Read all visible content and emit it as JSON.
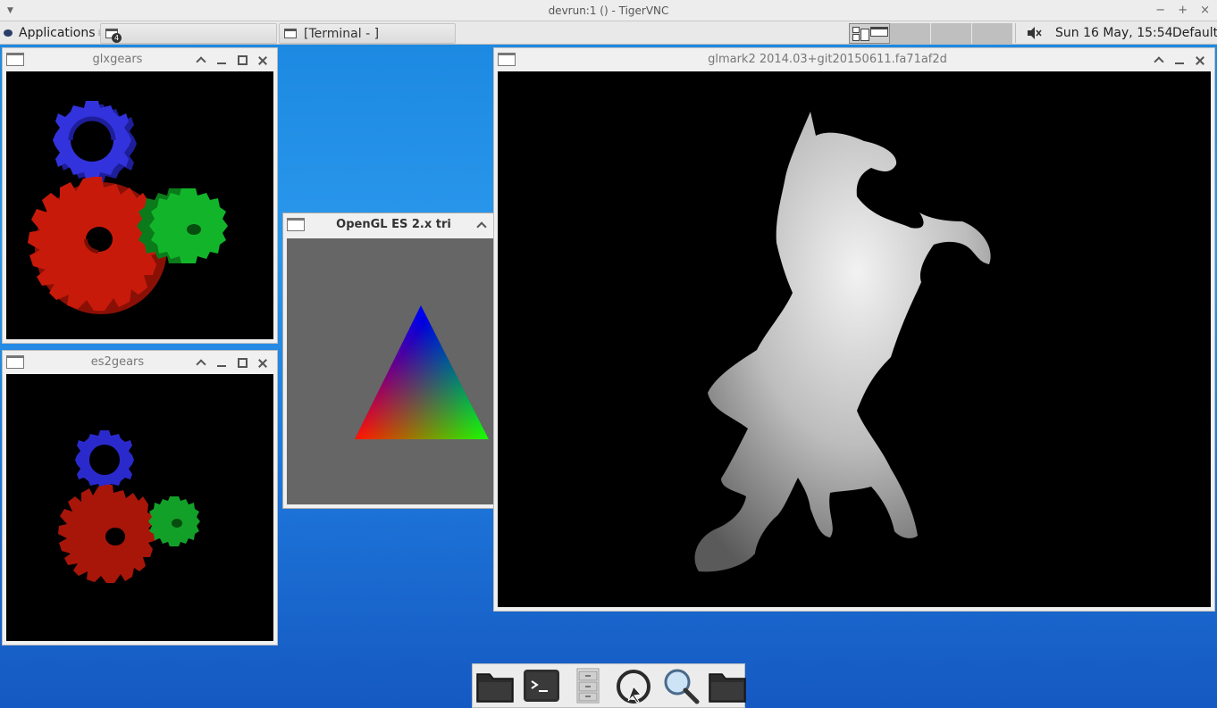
{
  "vnc": {
    "title": "devrun:1 () - TigerVNC",
    "controls": [
      "−",
      "+",
      "×"
    ]
  },
  "panel": {
    "applications_label": "Applications",
    "task_badge": "4",
    "terminal_task_label": "[Terminal - ]",
    "clock": "Sun 16 May, 15:54",
    "keyboard_layout": "Default"
  },
  "windows": {
    "glxgears": {
      "title": "glxgears"
    },
    "es2gears": {
      "title": "es2gears"
    },
    "es2tri": {
      "title": "OpenGL ES 2.x tri"
    },
    "glmark2": {
      "title": "glmark2 2014.03+git20150611.fa71af2d"
    }
  },
  "colors": {
    "gear_red": "#c81a0a",
    "gear_green": "#12b52a",
    "gear_blue": "#3030d8",
    "tri_bg": "#666666",
    "desktop": "#1a86e0"
  },
  "dock": {
    "items": [
      "folder-icon",
      "terminal-icon",
      "file-cabinet-icon",
      "web-browser-icon",
      "search-icon",
      "folder-icon"
    ]
  }
}
